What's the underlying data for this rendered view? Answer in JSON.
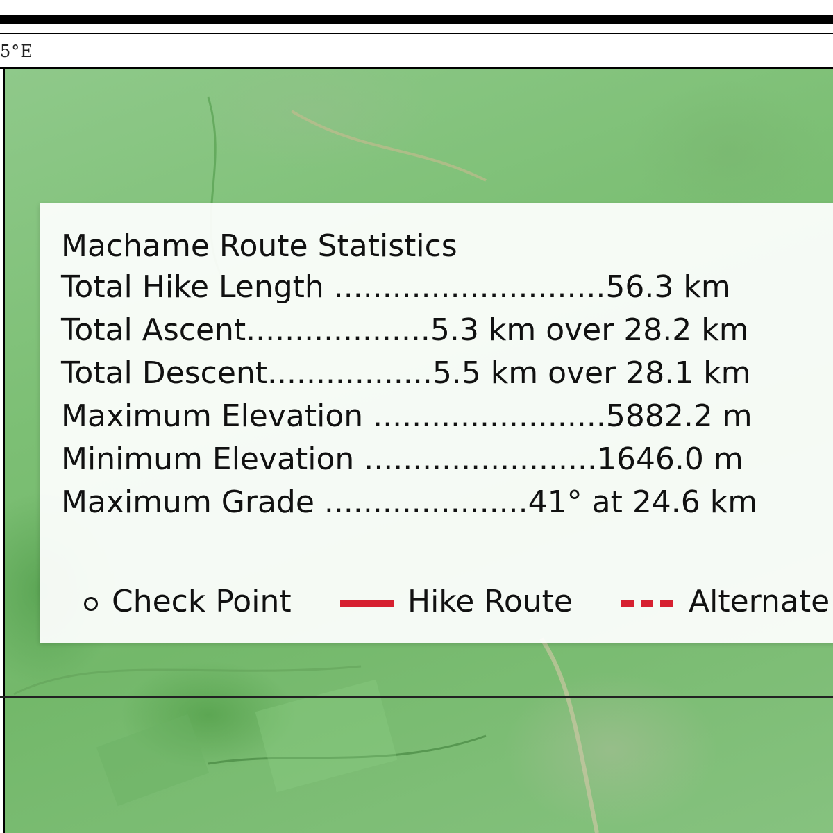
{
  "coordinate_label": "5°E",
  "panel": {
    "title": "Machame Route Statistics",
    "rows": [
      {
        "label": "Total Hike Length",
        "dots": " ............................",
        "value": "56.3 km"
      },
      {
        "label": "Total Ascent",
        "dots": "...................",
        "value": "5.3 km over 28.2 km"
      },
      {
        "label": "Total Descent",
        "dots": ".................",
        "value": "5.5 km over 28.1 km"
      },
      {
        "label": "Maximum Elevation",
        "dots": " ........................",
        "value": "5882.2 m"
      },
      {
        "label": "Minimum Elevation",
        "dots": " ........................",
        "value": "1646.0 m"
      },
      {
        "label": "Maximum Grade",
        "dots": " .....................",
        "value": "41° at 24.6 km"
      }
    ]
  },
  "legend": {
    "check_point": "Check Point",
    "hike_route": "Hike Route",
    "alternate": "Alternate",
    "route_color": "#d62030"
  }
}
